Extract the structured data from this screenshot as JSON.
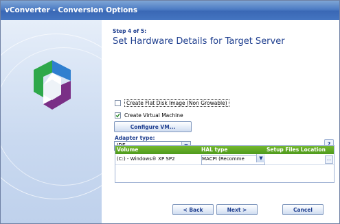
{
  "window": {
    "title": "vConverter - Conversion Options"
  },
  "wizard": {
    "step": "Step 4 of 5:",
    "heading": "Set Hardware Details for Target Server"
  },
  "options": {
    "flat_disk": {
      "label": "Create Flat Disk Image (Non Growable)",
      "checked": false
    },
    "create_vm": {
      "label": "Create Virtual Machine",
      "checked": true
    },
    "configure_vm_label": "Configure VM..."
  },
  "adapter": {
    "label": "Adapter type:",
    "value": "IDE",
    "help": "?"
  },
  "grid": {
    "columns": [
      "Volume",
      "HAL type",
      "Setup Files Location"
    ],
    "rows": [
      {
        "volume": "(C:) - Windows® XP SP2",
        "hal": "MACPI (Recomme",
        "location": "",
        "browse": "..."
      }
    ]
  },
  "buttons": {
    "back": "< Back",
    "next": "Next >",
    "cancel": "Cancel"
  },
  "colors": {
    "accent": "#1f3f8f",
    "grid_header": "#5aa622",
    "title_bar": "#4474c0"
  }
}
